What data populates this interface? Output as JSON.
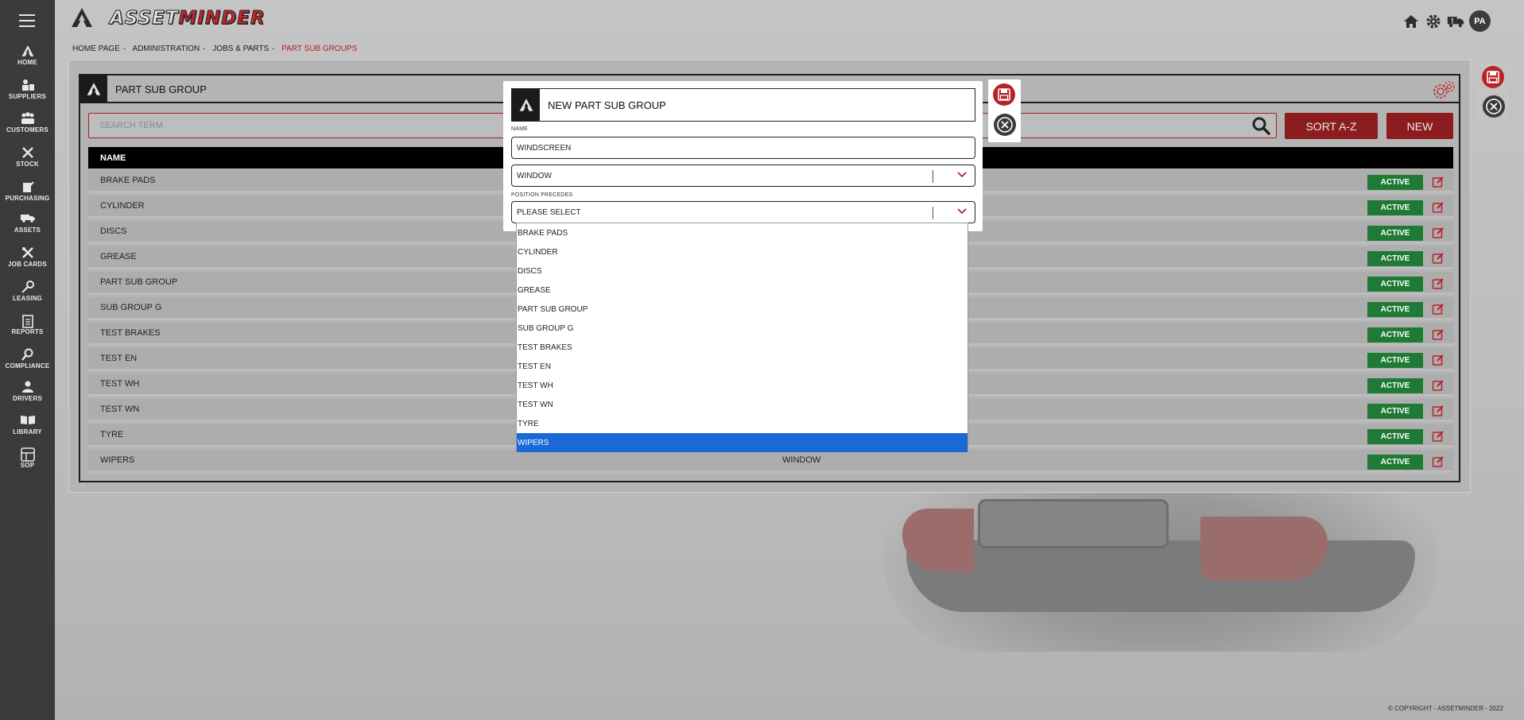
{
  "app": {
    "logo_text_a": "ASSET",
    "logo_text_b": "MINDER",
    "avatar": "PA",
    "copyright": "© COPYRIGHT - ASSETMINDER - 2022"
  },
  "sidebar": {
    "items": [
      {
        "label": "HOME",
        "icon": "home-logo-icon"
      },
      {
        "label": "SUPPLIERS",
        "icon": "suppliers-icon"
      },
      {
        "label": "CUSTOMERS",
        "icon": "customers-icon"
      },
      {
        "label": "STOCK",
        "icon": "tools-icon"
      },
      {
        "label": "PURCHASING",
        "icon": "purchasing-icon"
      },
      {
        "label": "ASSETS",
        "icon": "truck-icon"
      },
      {
        "label": "JOB CARDS",
        "icon": "wrench-icon"
      },
      {
        "label": "LEASING",
        "icon": "key-icon"
      },
      {
        "label": "REPORTS",
        "icon": "clipboard-icon"
      },
      {
        "label": "COMPLIANCE",
        "icon": "magnifier-icon"
      },
      {
        "label": "DRIVERS",
        "icon": "driver-icon"
      },
      {
        "label": "LIBRARY",
        "icon": "book-icon"
      },
      {
        "label": "SOP",
        "icon": "sop-icon"
      }
    ]
  },
  "breadcrumb": [
    "HOME PAGE",
    "ADMINISTRATION",
    "JOBS & PARTS",
    "PART SUB GROUPS"
  ],
  "panel": {
    "title": "PART SUB GROUP",
    "search_placeholder": "SEARCH TERM",
    "sort_label": "SORT A-Z",
    "new_label": "NEW",
    "column_name": "NAME",
    "rows": [
      {
        "name": "BRAKE PADS",
        "group": "",
        "status": "ACTIVE"
      },
      {
        "name": "CYLINDER",
        "group": "",
        "status": "ACTIVE"
      },
      {
        "name": "DISCS",
        "group": "",
        "status": "ACTIVE"
      },
      {
        "name": "GREASE",
        "group": "",
        "status": "ACTIVE"
      },
      {
        "name": "PART SUB GROUP",
        "group": "",
        "status": "ACTIVE"
      },
      {
        "name": "SUB GROUP G",
        "group": "",
        "status": "ACTIVE"
      },
      {
        "name": "TEST BRAKES",
        "group": "",
        "status": "ACTIVE"
      },
      {
        "name": "TEST EN",
        "group": "",
        "status": "ACTIVE"
      },
      {
        "name": "TEST WH",
        "group": "",
        "status": "ACTIVE"
      },
      {
        "name": "TEST WN",
        "group": "",
        "status": "ACTIVE"
      },
      {
        "name": "TYRE",
        "group": "",
        "status": "ACTIVE"
      },
      {
        "name": "WIPERS",
        "group": "WINDOW",
        "status": "ACTIVE"
      }
    ]
  },
  "modal": {
    "title": "NEW PART SUB GROUP",
    "name_label": "NAME",
    "name_value": "WINDSCREEN",
    "group_value": "WINDOW",
    "position_label": "POSITION PRECEDES",
    "position_value": "PLEASE SELECT",
    "options": [
      "BRAKE PADS",
      "CYLINDER",
      "DISCS",
      "GREASE",
      "PART SUB GROUP",
      "SUB GROUP G",
      "TEST BRAKES",
      "TEST EN",
      "TEST WH",
      "TEST WN",
      "TYRE",
      "WIPERS"
    ],
    "highlighted_option": "WIPERS"
  },
  "colors": {
    "brand_red": "#8d1c1f",
    "active_green": "#1e7a35",
    "select_blue": "#1b69d6",
    "sidebar": "#3a3b3d"
  }
}
